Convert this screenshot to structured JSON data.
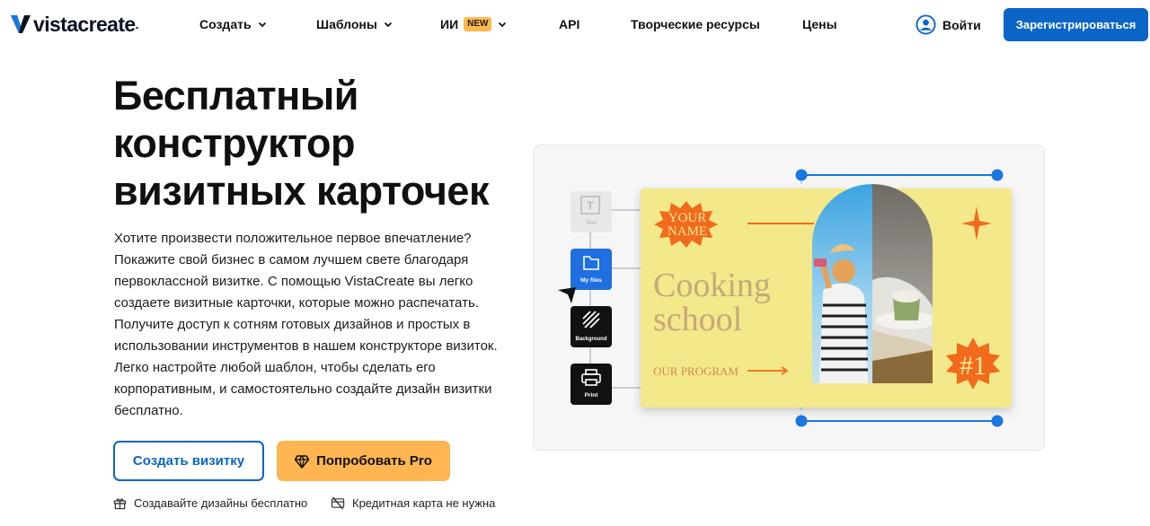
{
  "brand": {
    "name": "vistacreate",
    "dot": "."
  },
  "nav": {
    "create": "Создать",
    "templates": "Шаблоны",
    "ai": "ИИ",
    "ai_badge": "NEW",
    "api": "API",
    "resources": "Творческие ресурсы",
    "pricing": "Цены",
    "login": "Войти",
    "signup": "Зарегистрироваться"
  },
  "hero": {
    "title_line1": "Бесплатный",
    "title_line2": "конструктор",
    "title_line3": "визитных карточек",
    "description": "Хотите произвести положительное первое впечатление? Покажите свой бизнес в самом лучшем свете благодаря первоклассной визитке. С помощью VistaCreate вы легко создаете визитные карточки, которые можно распечатать. Получите доступ к сотням готовых дизайнов и простых в использовании инструментов в нашем конструкторе визиток. Легко настройте любой шаблон, чтобы сделать его корпоративным, и самостоятельно создайте дизайн визитки бесплатно.",
    "cta_primary": "Создать визитку",
    "cta_pro": "Попробовать Pro",
    "feature_free": "Создавайте дизайны бесплатно",
    "feature_card": "Кредитная карта не нужна"
  },
  "illustration": {
    "tools": [
      {
        "label": "Text",
        "icon": "text-icon"
      },
      {
        "label": "My files",
        "icon": "folder-icon"
      },
      {
        "label": "Background",
        "icon": "background-icon"
      },
      {
        "label": "Print",
        "icon": "print-icon"
      }
    ],
    "card": {
      "badge_line1": "YOUR",
      "badge_line2": "NAME",
      "headline_line1": "Cooking",
      "headline_line2": "school",
      "program": "OUR PROGRAM",
      "number": "#1"
    }
  },
  "colors": {
    "brand_blue": "#0b65c7",
    "pro_orange": "#ffb552",
    "card_yellow": "#f3e88a",
    "accent_orange": "#f26a1b",
    "tool_blue": "#1f6fe0",
    "handle_blue": "#1877e0"
  }
}
